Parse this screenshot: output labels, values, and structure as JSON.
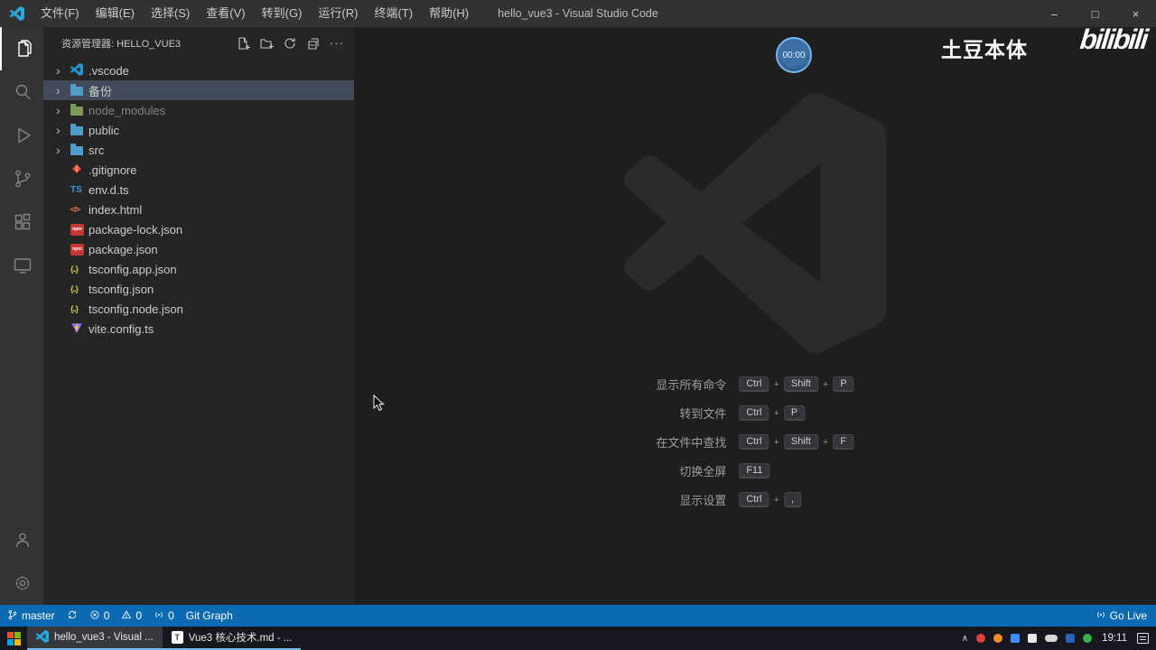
{
  "colors": {
    "accent_blue": "#0c6ab2",
    "folder_blue": "#4f9cc8",
    "folder_green": "#7a9b5c",
    "npm_red": "#c53635",
    "git_orange": "#e84e31",
    "vscode_blue": "#2796ce",
    "watermark_gray": "#2b2b2b"
  },
  "icons": {
    "minimize": "–",
    "maximize": "□",
    "close": "×",
    "chevron": "›",
    "more": "···",
    "tray_expand": "∧"
  },
  "title_bar": {
    "app_title": "hello_vue3 - Visual Studio Code",
    "menus": [
      "文件(F)",
      "编辑(E)",
      "选择(S)",
      "查看(V)",
      "转到(G)",
      "运行(R)",
      "终端(T)",
      "帮助(H)"
    ]
  },
  "activity_bar": {
    "top": [
      {
        "name": "explorer-icon",
        "active": true
      },
      {
        "name": "search-icon",
        "active": false
      },
      {
        "name": "run-debug-icon",
        "active": false
      },
      {
        "name": "source-control-icon",
        "active": false
      },
      {
        "name": "extensions-icon",
        "active": false
      },
      {
        "name": "remote-explorer-icon",
        "active": false
      }
    ],
    "bottom": [
      {
        "name": "account-icon",
        "active": false
      },
      {
        "name": "settings-gear-icon",
        "active": false
      }
    ]
  },
  "sidebar": {
    "header": "资源管理器: HELLO_VUE3",
    "actions": [
      "new-file-icon",
      "new-folder-icon",
      "refresh-icon",
      "collapse-all-icon",
      "more-actions-icon"
    ],
    "items": [
      {
        "label": ".vscode",
        "kind": "folder",
        "icon": "vscode",
        "selected": false,
        "dim": false
      },
      {
        "label": "备份",
        "kind": "folder",
        "icon": "folder",
        "selected": true,
        "dim": false
      },
      {
        "label": "node_modules",
        "kind": "folder",
        "icon": "folder-green",
        "selected": false,
        "dim": true
      },
      {
        "label": "public",
        "kind": "folder",
        "icon": "folder",
        "selected": false,
        "dim": false
      },
      {
        "label": "src",
        "kind": "folder",
        "icon": "folder",
        "selected": false,
        "dim": false
      },
      {
        "label": ".gitignore",
        "kind": "file",
        "icon": "git",
        "selected": false,
        "dim": false
      },
      {
        "label": "env.d.ts",
        "kind": "file",
        "icon": "ts",
        "selected": false,
        "dim": false
      },
      {
        "label": "index.html",
        "kind": "file",
        "icon": "html",
        "selected": false,
        "dim": false
      },
      {
        "label": "package-lock.json",
        "kind": "file",
        "icon": "npm",
        "selected": false,
        "dim": false
      },
      {
        "label": "package.json",
        "kind": "file",
        "icon": "npm",
        "selected": false,
        "dim": false
      },
      {
        "label": "tsconfig.app.json",
        "kind": "file",
        "icon": "json",
        "selected": false,
        "dim": false
      },
      {
        "label": "tsconfig.json",
        "kind": "file",
        "icon": "json",
        "selected": false,
        "dim": false
      },
      {
        "label": "tsconfig.node.json",
        "kind": "file",
        "icon": "json",
        "selected": false,
        "dim": false
      },
      {
        "label": "vite.config.ts",
        "kind": "file",
        "icon": "vite",
        "selected": false,
        "dim": false
      }
    ]
  },
  "editor": {
    "shortcuts": [
      {
        "label": "显示所有命令",
        "keys": [
          "Ctrl",
          "Shift",
          "P"
        ]
      },
      {
        "label": "转到文件",
        "keys": [
          "Ctrl",
          "P"
        ]
      },
      {
        "label": "在文件中查找",
        "keys": [
          "Ctrl",
          "Shift",
          "F"
        ]
      },
      {
        "label": "切换全屏",
        "keys": [
          "F11"
        ]
      },
      {
        "label": "显示设置",
        "keys": [
          "Ctrl",
          ","
        ]
      }
    ]
  },
  "overlay": {
    "timer": "00:00",
    "watermark_text": "土豆本体",
    "logo_text": "bilibili"
  },
  "status_bar": {
    "left": [
      {
        "icon": "branch-icon",
        "label": "master"
      },
      {
        "icon": "sync-icon",
        "label": ""
      },
      {
        "icon": "error-icon",
        "label": "0"
      },
      {
        "icon": "warning-icon",
        "label": "0"
      },
      {
        "icon": "ports-icon",
        "label": "0"
      },
      {
        "icon": "",
        "label": "Git Graph"
      }
    ],
    "right": [
      {
        "icon": "broadcast-icon",
        "label": "Go Live"
      }
    ]
  },
  "taskbar": {
    "apps": [
      {
        "label": "hello_vue3 - Visual ...",
        "icon": "vscode",
        "active": true
      },
      {
        "label": "Vue3 核心技术.md - ...",
        "icon": "doc",
        "active": false
      }
    ],
    "tray": [
      {
        "name": "tray-app-red-icon",
        "color": "#e0403a",
        "shape": "circle"
      },
      {
        "name": "tray-app-orange-icon",
        "color": "#f08c2e",
        "shape": "circle"
      },
      {
        "name": "tray-app-blue-icon",
        "color": "#3f8cff",
        "shape": "square"
      },
      {
        "name": "tray-keyboard-icon",
        "color": "#e8e8e8",
        "shape": "square"
      },
      {
        "name": "tray-cloud-icon",
        "color": "#d8d8d8",
        "shape": "cloud"
      },
      {
        "name": "tray-app-navy-icon",
        "color": "#2b5fb8",
        "shape": "square"
      },
      {
        "name": "tray-app-green-icon",
        "color": "#37b24d",
        "shape": "circle"
      }
    ],
    "time": "19:11"
  }
}
